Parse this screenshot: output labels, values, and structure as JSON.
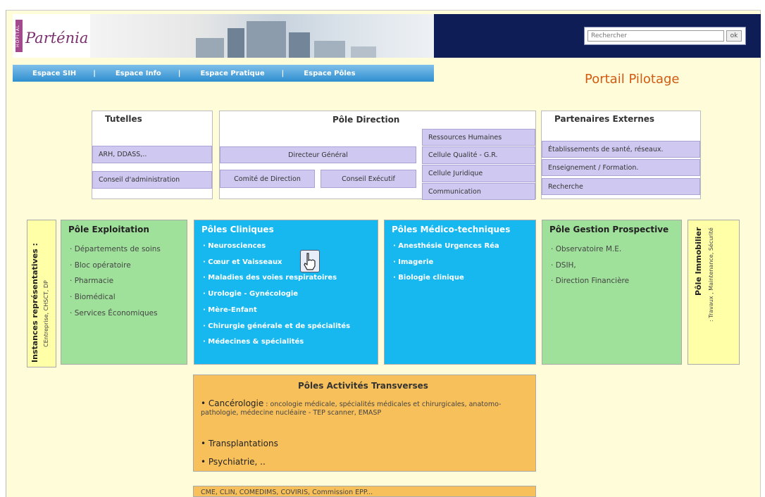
{
  "header": {
    "logo_side": "HOPITAL",
    "logo_name": "Parténia",
    "search_placeholder": "Rechercher",
    "search_button": "ok",
    "portal_title": "Portail Pilotage"
  },
  "nav": [
    "Espace SIH",
    "|",
    "Espace Info",
    "|",
    "Espace Pratique",
    "|",
    "Espace Pôles"
  ],
  "tutelles": {
    "title": "Tutelles",
    "items": [
      "ARH, DDASS,..",
      "Conseil d'administration"
    ]
  },
  "direction": {
    "title": "Pôle Direction",
    "dg": "Directeur Général",
    "comite": "Comité de Direction",
    "conseil": "Conseil Exécutif",
    "right_items": [
      "Ressources Humaines",
      "Cellule Qualité - G.R.",
      "Cellule Juridique",
      "Communication"
    ]
  },
  "partenaires": {
    "title": "Partenaires Externes",
    "items": [
      "Établissements de santé, réseaux.",
      "Enseignement / Formation.",
      "Recherche"
    ]
  },
  "instances": {
    "title": "Instances représentatives :",
    "subtitle": "CEntreprise, CHSCT, DP"
  },
  "exploitation": {
    "title": "Pôle Exploitation",
    "items": [
      "Départements de soins",
      "Bloc opératoire",
      "Pharmacie",
      "Biomédical",
      "Services Économiques"
    ]
  },
  "cliniques": {
    "title": "Pôles Cliniques",
    "items": [
      "Neurosciences",
      "Cœur et Vaisseaux",
      "Maladies des voies respiratoires",
      "Urologie - Gynécologie",
      "Mère-Enfant",
      "Chirurgie générale et de spécialités",
      "Médecines & spécialités"
    ]
  },
  "medico": {
    "title": "Pôles Médico-techniques",
    "items": [
      "Anesthésie Urgences Réa",
      "Imagerie",
      "Biologie clinique"
    ]
  },
  "gestion": {
    "title": "Pôle Gestion Prospective",
    "items": [
      "Observatoire M.E.",
      "DSIH,",
      "Direction Financière"
    ]
  },
  "immobilier": {
    "title": "Pôle Immobilier",
    "subtitle": ": Travaux , Maintenance, Sécurité"
  },
  "transverses": {
    "title": "Pôles Activités Transverses",
    "canc_label": "Cancérologie",
    "canc_detail": ": oncologie médicale, spécialités médicales et chirurgicales, anatomo-pathologie, médecine nucléaire - TEP scanner, EMASP",
    "transplant": "Transplantations",
    "psy": "Psychiatrie, ..",
    "bottom": "CME, CLIN, COMEDIMS, COVIRIS, Commission EPP..."
  }
}
